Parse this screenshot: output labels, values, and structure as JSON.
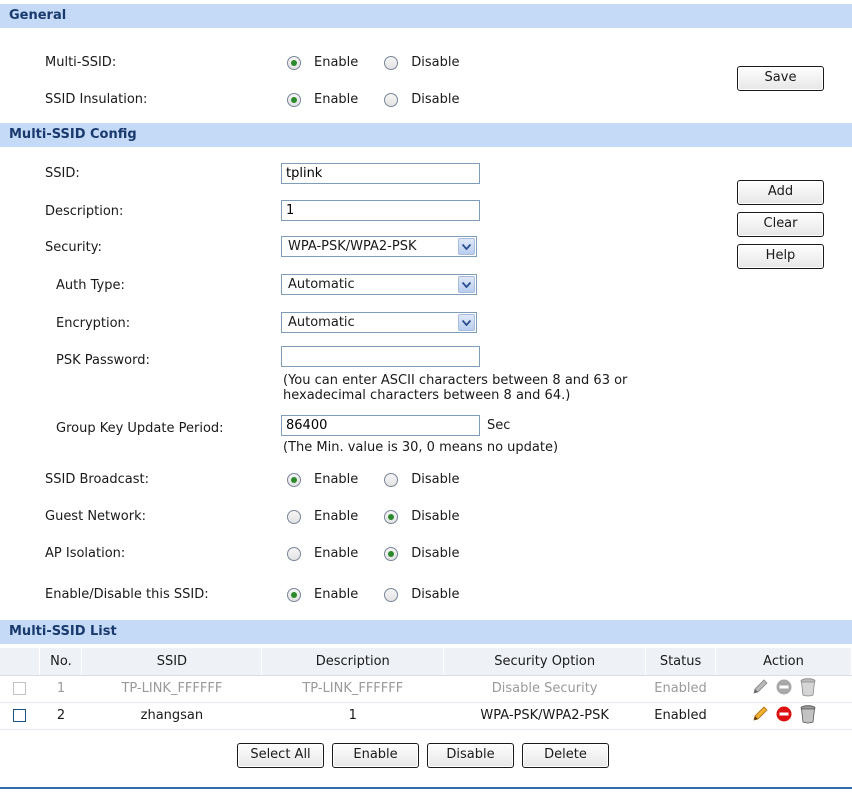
{
  "general": {
    "header": "General",
    "multi_ssid": {
      "label": "Multi-SSID:",
      "enable": "Enable",
      "disable": "Disable",
      "selected": "enable"
    },
    "ssid_insulation": {
      "label": "SSID Insulation:",
      "enable": "Enable",
      "disable": "Disable",
      "selected": "enable"
    },
    "save_label": "Save"
  },
  "config": {
    "header": "Multi-SSID Config",
    "ssid": {
      "label": "SSID:",
      "value": "tplink"
    },
    "description": {
      "label": "Description:",
      "value": "1"
    },
    "security": {
      "label": "Security:",
      "value": "WPA-PSK/WPA2-PSK"
    },
    "auth_type": {
      "label": "Auth Type:",
      "value": "Automatic"
    },
    "encryption": {
      "label": "Encryption:",
      "value": "Automatic"
    },
    "psk_password": {
      "label": "PSK Password:",
      "value": "",
      "note_line1": "(You can enter ASCII characters between 8 and 63 or",
      "note_line2": "hexadecimal characters between 8 and 64.)"
    },
    "group_key": {
      "label": "Group Key Update Period:",
      "value": "86400",
      "unit": "Sec",
      "note": "(The Min. value is 30, 0 means no update)"
    },
    "ssid_broadcast": {
      "label": "SSID Broadcast:",
      "enable": "Enable",
      "disable": "Disable",
      "selected": "enable"
    },
    "guest_network": {
      "label": "Guest Network:",
      "enable": "Enable",
      "disable": "Disable",
      "selected": "disable"
    },
    "ap_isolation": {
      "label": "AP Isolation:",
      "enable": "Enable",
      "disable": "Disable",
      "selected": "disable"
    },
    "enable_ssid": {
      "label": "Enable/Disable this SSID:",
      "enable": "Enable",
      "disable": "Disable",
      "selected": "enable"
    },
    "add_label": "Add",
    "clear_label": "Clear",
    "help_label": "Help"
  },
  "list": {
    "header": "Multi-SSID List",
    "columns": [
      "No.",
      "SSID",
      "Description",
      "Security Option",
      "Status",
      "Action"
    ],
    "rows": [
      {
        "no": "1",
        "ssid": "TP-LINK_FFFFFF",
        "description": "TP-LINK_FFFFFF",
        "security": "Disable Security",
        "status": "Enabled"
      },
      {
        "no": "2",
        "ssid": "zhangsan",
        "description": "1",
        "security": "WPA-PSK/WPA2-PSK",
        "status": "Enabled"
      }
    ],
    "buttons": {
      "select_all": "Select All",
      "enable": "Enable",
      "disable": "Disable",
      "delete": "Delete"
    }
  },
  "colors": {
    "header_bg": "#c4daf7",
    "header_text": "#1a3a6e",
    "radio_checked": "#2b8a2b",
    "edit_icon": "#e8a020",
    "delete_icon": "#dd1111"
  }
}
